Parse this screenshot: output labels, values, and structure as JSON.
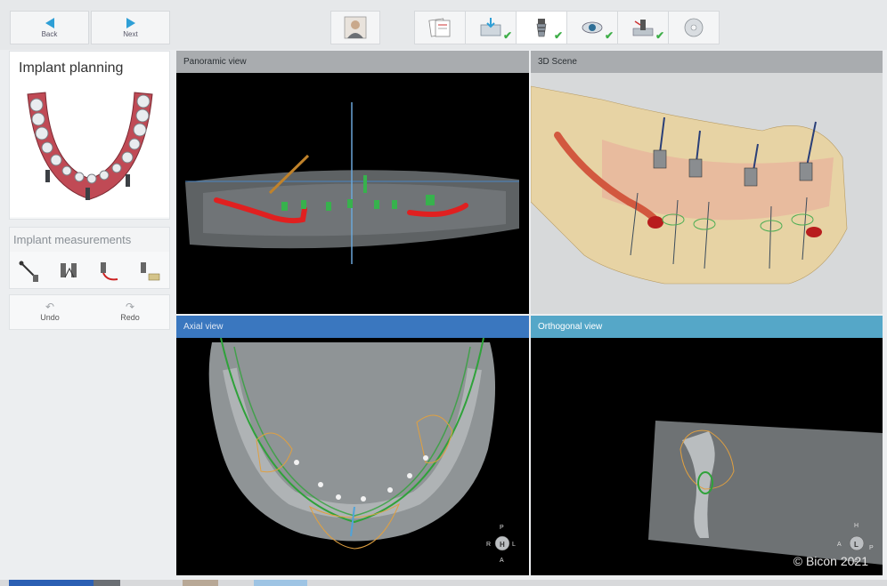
{
  "toolbar": {
    "back_label": "Back",
    "next_label": "Next"
  },
  "panel": {
    "title": "Implant planning",
    "measurements_label": "Implant measurements",
    "undo_label": "Undo",
    "redo_label": "Redo",
    "tools": [
      "distance-measure-icon",
      "angle-measure-icon",
      "curve-measure-icon",
      "density-measure-icon"
    ]
  },
  "views": {
    "panoramic": "Panoramic view",
    "scene3d": "3D Scene",
    "axial": "Axial view",
    "orthogonal": "Orthogonal view"
  },
  "orientation": {
    "axial": {
      "top": "P",
      "left": "R",
      "center": "H",
      "right": "L",
      "bottom": "A"
    },
    "ortho": {
      "top": "H",
      "left": "A",
      "center": "L",
      "right": "P",
      "bottom": "F"
    }
  },
  "copyright": "© Bicon 2021",
  "colors": {
    "accent": "#2e9fd6",
    "check": "#3fae49",
    "nerve": "#e02020",
    "axial_header": "#3a77bf",
    "ortho_header": "#55a7c8"
  },
  "steps": [
    "patient-icon",
    "documents-icon",
    "import-icon",
    "implant-icon",
    "view-icon",
    "surgical-guide-icon",
    "export-disc-icon"
  ]
}
